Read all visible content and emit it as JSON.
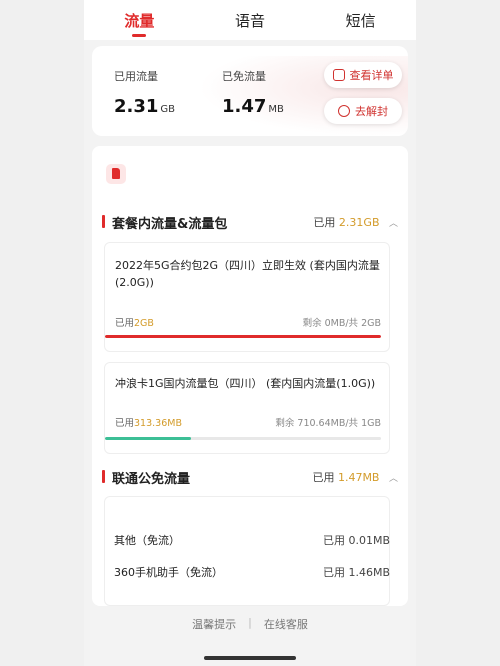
{
  "tabs": [
    {
      "label": "流量",
      "active": true
    },
    {
      "label": "语音",
      "active": false
    },
    {
      "label": "短信",
      "active": false
    }
  ],
  "summary": {
    "used": {
      "label": "已用流量",
      "value": "2.31",
      "unit": "GB"
    },
    "free": {
      "label": "已免流量",
      "value": "1.47",
      "unit": "MB"
    },
    "detail_button": "查看详单",
    "unseal_button": "去解封"
  },
  "package_section": {
    "title": "套餐内流量&流量包",
    "used_prefix": "已用",
    "used_amount": "2.31GB",
    "items": [
      {
        "title": "2022年5G合约包2G（四川）立即生效 (套内国内流量(2.0G))",
        "used_prefix": "已用",
        "used_amount": "2GB",
        "remain": "剩余 0MB/共 2GB",
        "progress": 1.0,
        "color": "#e02b2b"
      },
      {
        "title": "冲浪卡1G国内流量包（四川） (套内国内流量(1.0G))",
        "used_prefix": "已用",
        "used_amount": "313.36MB",
        "remain": "剩余 710.64MB/共 1GB",
        "progress": 0.31,
        "color": "#3cbf96"
      }
    ]
  },
  "free_section": {
    "title": "联通公免流量",
    "used_prefix": "已用",
    "used_amount": "1.47MB",
    "items": [
      {
        "name": "其他（免流）",
        "value": "已用 0.01MB"
      },
      {
        "name": "360手机助手（免流）",
        "value": "已用 1.46MB"
      }
    ]
  },
  "footer": {
    "tip": "温馨提示",
    "service": "在线客服"
  },
  "colors": {
    "accent": "#e02b2b",
    "amount": "#d39b2a",
    "progress_green": "#3cbf96"
  }
}
